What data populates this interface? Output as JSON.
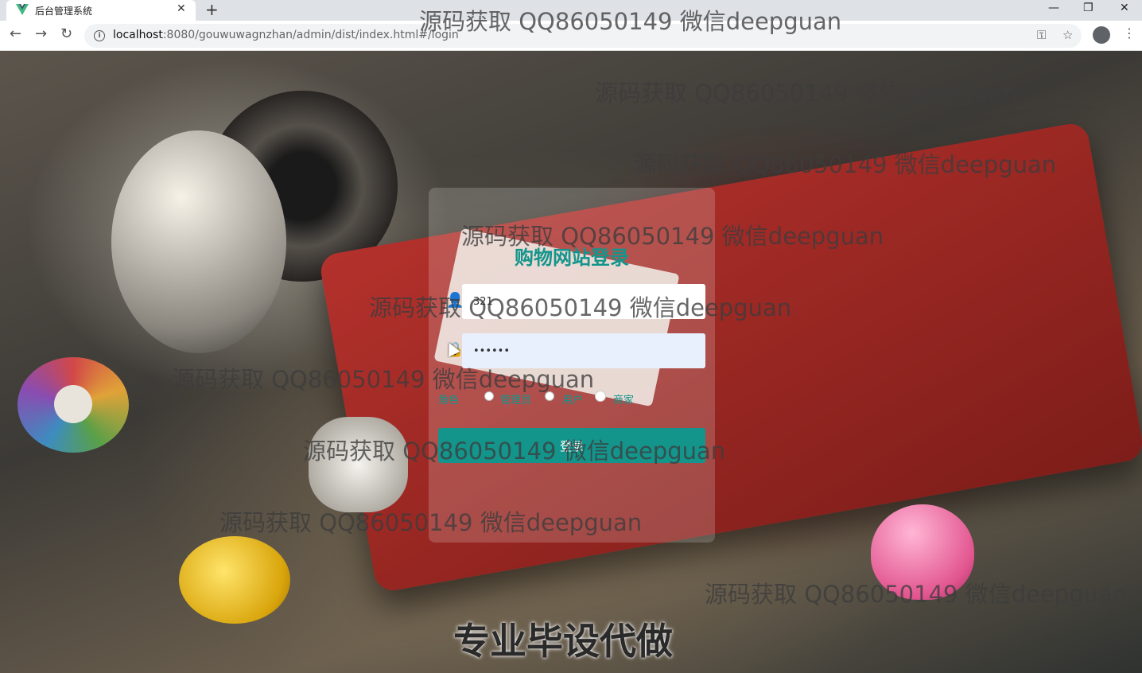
{
  "browser": {
    "tab_title": "后台管理系统",
    "tab_close": "✕",
    "new_tab": "+",
    "url_host": "localhost",
    "url_rest": ":8080/gouwuwagnzhan/admin/dist/index.html#/login",
    "window_controls": [
      "—",
      "❐",
      "✕"
    ]
  },
  "login": {
    "title": "购物网站登录",
    "username_value": "321",
    "password_value": "••••••",
    "role_label": "角色",
    "roles": [
      "管理员",
      "用户",
      "商家"
    ],
    "selected_role": "商家",
    "submit_label": "登录"
  },
  "watermarks": [
    "源码获取 QQ86050149 微信deepguan",
    "源码获取 QQ86050149 微信deepguan",
    "源码获取 QQ86050149 微信deepguan",
    "源码获取 QQ86050149 微信deepguan",
    "源码获取 QQ86050149 微信deepguan",
    "源码获取 QQ86050149 微信deepguan",
    "源码获取 QQ86050149 微信deepguan",
    "源码获取 QQ86050149 微信deepguan",
    "源码获取 QQ86050149 微信deepguan"
  ],
  "banner": "专业毕设代做",
  "colors": {
    "accent": "#13958c",
    "password_bg": "#e8f0fe"
  },
  "icons": {
    "favicon": "vue-logo-icon",
    "back": "arrow-left-icon",
    "forward": "arrow-right-icon",
    "reload": "reload-icon",
    "site_info": "info-icon",
    "key": "key-icon",
    "bookmark": "star-icon",
    "profile": "avatar-icon",
    "menu": "more-vert-icon"
  }
}
